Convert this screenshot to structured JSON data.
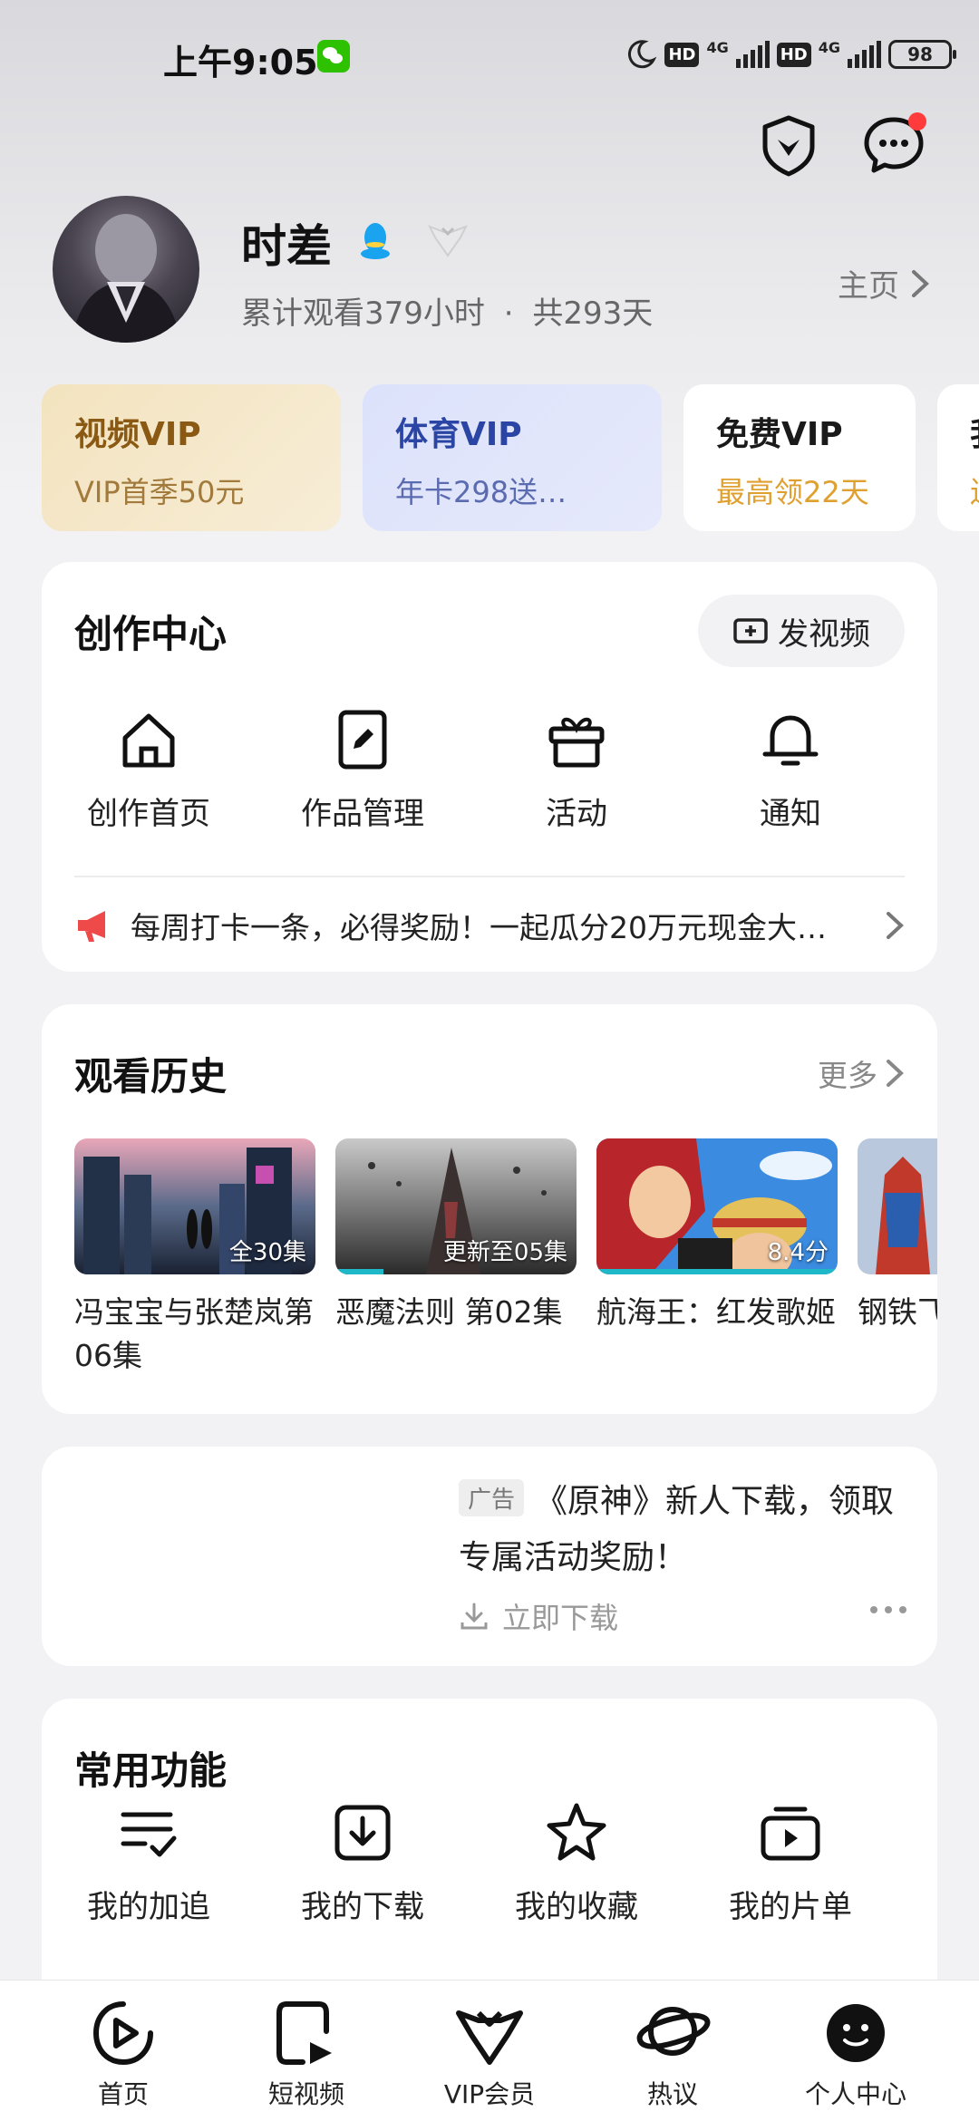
{
  "status_bar": {
    "time": "上午9:05",
    "hd1": "HD",
    "net1": "4G",
    "hd2": "HD",
    "net2": "4G",
    "battery": "98"
  },
  "profile": {
    "username": "时差",
    "watch_time": "累计观看379小时",
    "separator": "·",
    "days": "共293天",
    "homepage_label": "主页"
  },
  "vip_cards": [
    {
      "title": "视频VIP",
      "subtitle": "VIP首季50元"
    },
    {
      "title": "体育VIP",
      "subtitle": "年卡298送…"
    },
    {
      "title": "免费VIP",
      "subtitle": "最高领22天"
    },
    {
      "title": "我",
      "subtitle": "送"
    }
  ],
  "creation_center": {
    "title": "创作中心",
    "post_video_label": "发视频",
    "tools": [
      {
        "label": "创作首页",
        "icon": "home-icon"
      },
      {
        "label": "作品管理",
        "icon": "edit-icon"
      },
      {
        "label": "活动",
        "icon": "gift-icon"
      },
      {
        "label": "通知",
        "icon": "bell-icon"
      }
    ],
    "announcement": "每周打卡一条，必得奖励！一起瓜分20万元现金大…"
  },
  "watch_history": {
    "title": "观看历史",
    "more_label": "更多",
    "items": [
      {
        "title": "冯宝宝与张楚岚第06集",
        "badge": "全30集",
        "progress": 0
      },
      {
        "title": "恶魔法则 第02集",
        "badge": "更新至05集",
        "progress": 0.2
      },
      {
        "title": "航海王：红发歌姬",
        "badge": "8.4分",
        "progress": 1
      },
      {
        "title": "钢铁飞龙之奥特曼",
        "badge": "",
        "progress": 0
      }
    ]
  },
  "ad": {
    "tag": "广告",
    "text": "《原神》新人下载，领取专属活动奖励！",
    "download_label": "立即下载"
  },
  "common_functions": {
    "title": "常用功能",
    "items": [
      {
        "label": "我的加追",
        "icon": "list-check-icon"
      },
      {
        "label": "我的下载",
        "icon": "download-icon"
      },
      {
        "label": "我的收藏",
        "icon": "star-icon"
      },
      {
        "label": "我的片单",
        "icon": "playlist-icon"
      }
    ]
  },
  "bottom_nav": {
    "items": [
      {
        "label": "首页",
        "icon": "play-circle-icon"
      },
      {
        "label": "短视频",
        "icon": "short-video-icon"
      },
      {
        "label": "VIP会员",
        "icon": "vip-icon"
      },
      {
        "label": "热议",
        "icon": "planet-icon"
      },
      {
        "label": "个人中心",
        "icon": "profile-face-icon",
        "active": true
      }
    ]
  },
  "colors": {
    "accent_teal": "#1fb8c9",
    "notification_dot": "#ff3b3b",
    "vip_gold": "#8a5a14",
    "sports_blue": "#2b45a5",
    "free_vip_orange": "#e0a030"
  }
}
